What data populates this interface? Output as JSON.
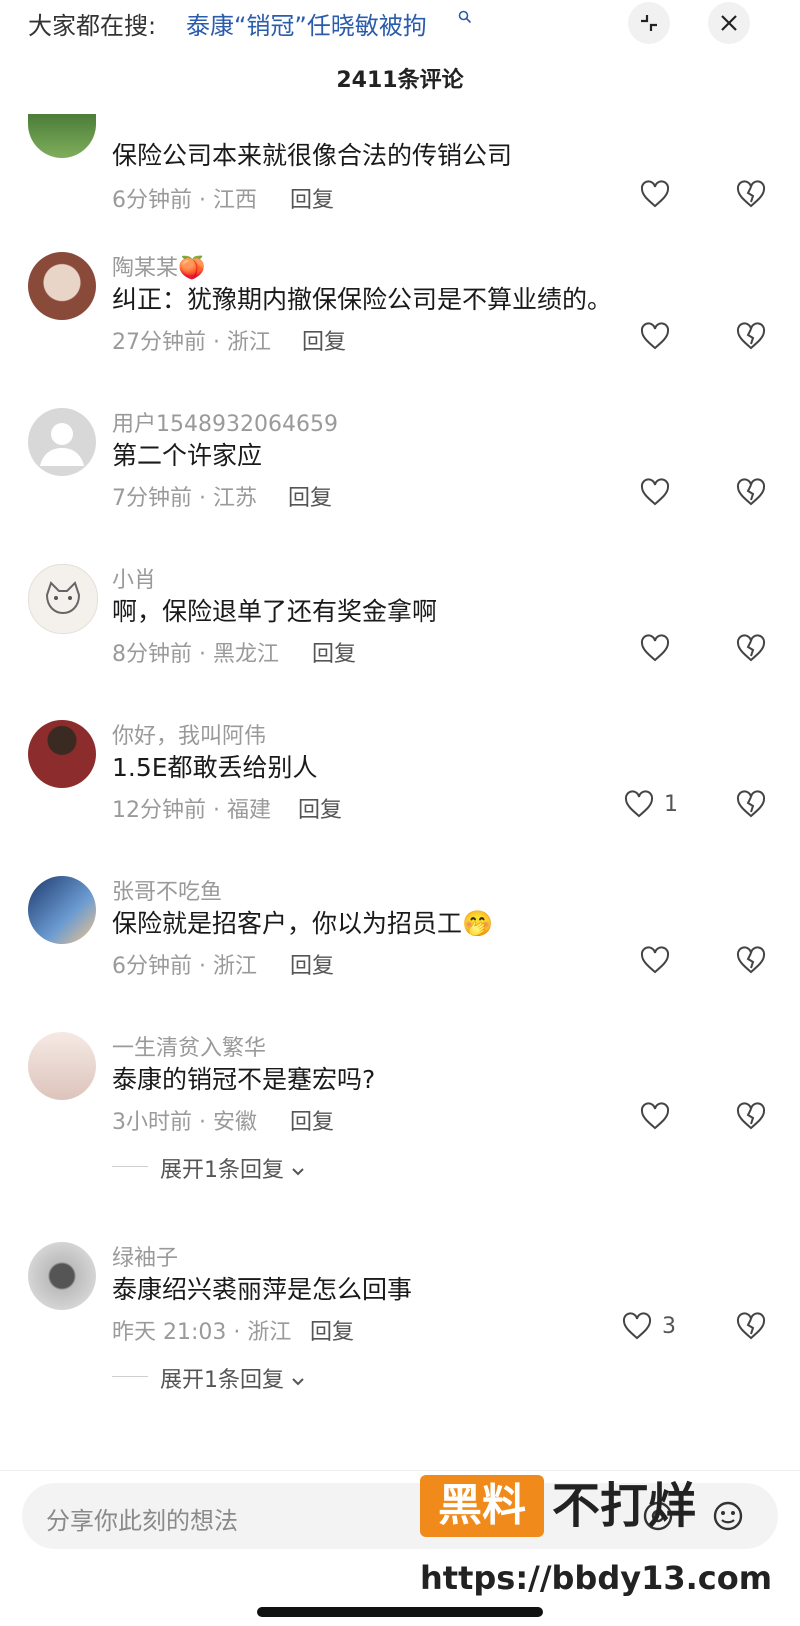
{
  "header": {
    "search_prefix": "大家都在搜:",
    "search_query": "泰康“销冠”任晓敏被拘",
    "comment_count": "2411条评论"
  },
  "comments": [
    {
      "name": "",
      "text": "保险公司本来就很像合法的传销公司",
      "meta": "6分钟前 · 江西",
      "reply": "回复",
      "likes": ""
    },
    {
      "name": "陶某某🍑",
      "text": "纠正：犹豫期内撤保保险公司是不算业绩的。",
      "meta": "27分钟前 · 浙江",
      "reply": "回复",
      "likes": ""
    },
    {
      "name": "用户1548932064659",
      "text": "第二个许家应",
      "meta": "7分钟前 · 江苏",
      "reply": "回复",
      "likes": ""
    },
    {
      "name": "小肖",
      "text": "啊，保险退单了还有奖金拿啊",
      "meta": "8分钟前 · 黑龙江",
      "reply": "回复",
      "likes": ""
    },
    {
      "name": "你好，我叫阿伟",
      "text": "1.5E都敢丢给别人",
      "meta": "12分钟前 · 福建",
      "reply": "回复",
      "likes": "1"
    },
    {
      "name": "张哥不吃鱼",
      "text": "保险就是招客户，你以为招员工🤭",
      "meta": "6分钟前 · 浙江",
      "reply": "回复",
      "likes": ""
    },
    {
      "name": "一生清贫入繁华",
      "text": "泰康的销冠不是蹇宏吗?",
      "meta": "3小时前 · 安徽",
      "reply": "回复",
      "likes": "",
      "expand": "展开1条回复"
    },
    {
      "name": "绿袖子",
      "text": "泰康绍兴裘丽萍是怎么回事",
      "meta": "昨天 21:03 · 浙江",
      "reply": "回复",
      "likes": "3",
      "expand": "展开1条回复"
    }
  ],
  "footer": {
    "placeholder": "分享你此刻的想法",
    "watermark_box": "黑料",
    "watermark_text": "不打烊",
    "watermark_url": "https://bbdy13.com"
  }
}
